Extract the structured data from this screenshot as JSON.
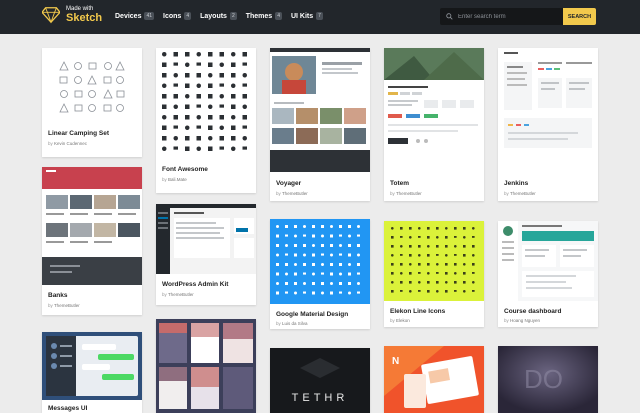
{
  "brand": {
    "small": "Made with",
    "big": "Sketch"
  },
  "nav": [
    {
      "label": "Devices",
      "count": "41"
    },
    {
      "label": "Icons",
      "count": "4"
    },
    {
      "label": "Layouts",
      "count": "2"
    },
    {
      "label": "Themes",
      "count": "4"
    },
    {
      "label": "UI Kits",
      "count": "7"
    }
  ],
  "search": {
    "placeholder": "Enter search term",
    "button": "SEARCH"
  },
  "by_prefix": "by",
  "cards": [
    {
      "title": "Linear Camping Set",
      "author": "Kevin Cudennec"
    },
    {
      "title": "Font Awesome",
      "author": "Bali.Mate"
    },
    {
      "title": "Voyager",
      "author": "ThemeButler"
    },
    {
      "title": "Totem",
      "author": "ThemeButler"
    },
    {
      "title": "Jenkins",
      "author": "ThemeButler"
    },
    {
      "title": "Banks",
      "author": "ThemeButler"
    },
    {
      "title": "WordPress Admin Kit",
      "author": "ThemeButler"
    },
    {
      "title": "Google Material Design",
      "author": "Luis da Silva"
    },
    {
      "title": "Elekon Line Icons",
      "author": "Elekon"
    },
    {
      "title": "Course dashboard",
      "author": "Hoang Nguyen"
    },
    {
      "title": "Messages UI",
      "author": ""
    }
  ],
  "tethr_text": "TETHR",
  "colors": {
    "accent": "#f2c94c",
    "topbar": "#22262b",
    "material_blue": "#2196f3",
    "lime": "#dbf23a"
  }
}
